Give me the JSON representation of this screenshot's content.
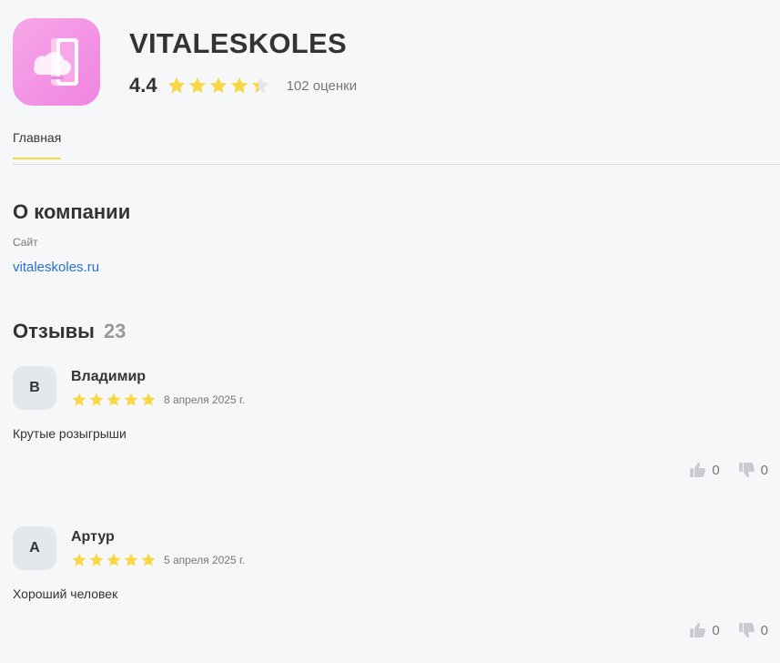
{
  "app": {
    "title": "VITALESKOLES",
    "rating": "4.4",
    "rating_value": 4.4,
    "rating_count": "102 оценки"
  },
  "colors": {
    "star": "#f7d843",
    "star_empty": "#e3e7ed",
    "accent": "#f7d843",
    "link": "#2a6fcf"
  },
  "tabs": [
    {
      "label": "Главная"
    }
  ],
  "about": {
    "title": "О компании",
    "site_label": "Сайт",
    "site_value": "vitaleskoles.ru"
  },
  "reviews": {
    "title": "Отзывы",
    "count": "23",
    "items": [
      {
        "initial": "В",
        "name": "Владимир",
        "stars": 5,
        "date": "8 апреля 2025 г.",
        "text": "Крутые розыгрыши",
        "likes": "0",
        "dislikes": "0"
      },
      {
        "initial": "А",
        "name": "Артур",
        "stars": 5,
        "date": "5 апреля 2025 г.",
        "text": "Хороший человек",
        "likes": "0",
        "dislikes": "0"
      }
    ]
  }
}
